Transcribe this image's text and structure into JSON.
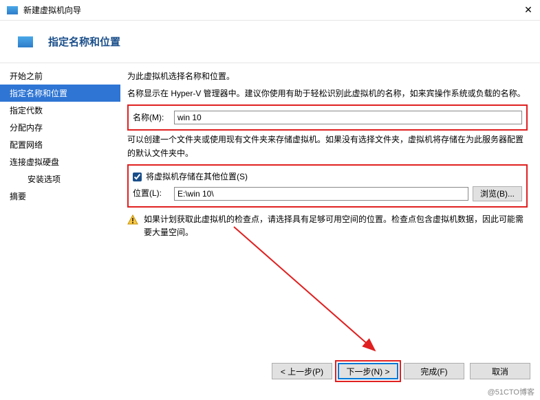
{
  "titlebar": {
    "title": "新建虚拟机向导",
    "close": "✕"
  },
  "header": {
    "title": "指定名称和位置"
  },
  "sidebar": {
    "items": [
      {
        "label": "开始之前"
      },
      {
        "label": "指定名称和位置",
        "selected": true
      },
      {
        "label": "指定代数"
      },
      {
        "label": "分配内存"
      },
      {
        "label": "配置网络"
      },
      {
        "label": "连接虚拟硬盘"
      },
      {
        "label": "安装选项",
        "indent": true
      },
      {
        "label": "摘要"
      }
    ]
  },
  "content": {
    "intro": "为此虚拟机选择名称和位置。",
    "name_desc": "名称显示在 Hyper-V 管理器中。建议你使用有助于轻松识别此虚拟机的名称，如来宾操作系统或负载的名称。",
    "name_label": "名称(M):",
    "name_value": "win 10",
    "loc_desc": "可以创建一个文件夹或使用现有文件夹来存储虚拟机。如果没有选择文件夹，虚拟机将存储在为此服务器配置的默认文件夹中。",
    "store_chk": "将虚拟机存储在其他位置(S)",
    "loc_label": "位置(L):",
    "loc_value": "E:\\win 10\\",
    "browse": "浏览(B)...",
    "warning": "如果计划获取此虚拟机的检查点，请选择具有足够可用空间的位置。检查点包含虚拟机数据，因此可能需要大量空间。"
  },
  "footer": {
    "prev": "< 上一步(P)",
    "next": "下一步(N) >",
    "finish": "完成(F)",
    "cancel": "取消"
  },
  "watermark": "@51CTO博客"
}
